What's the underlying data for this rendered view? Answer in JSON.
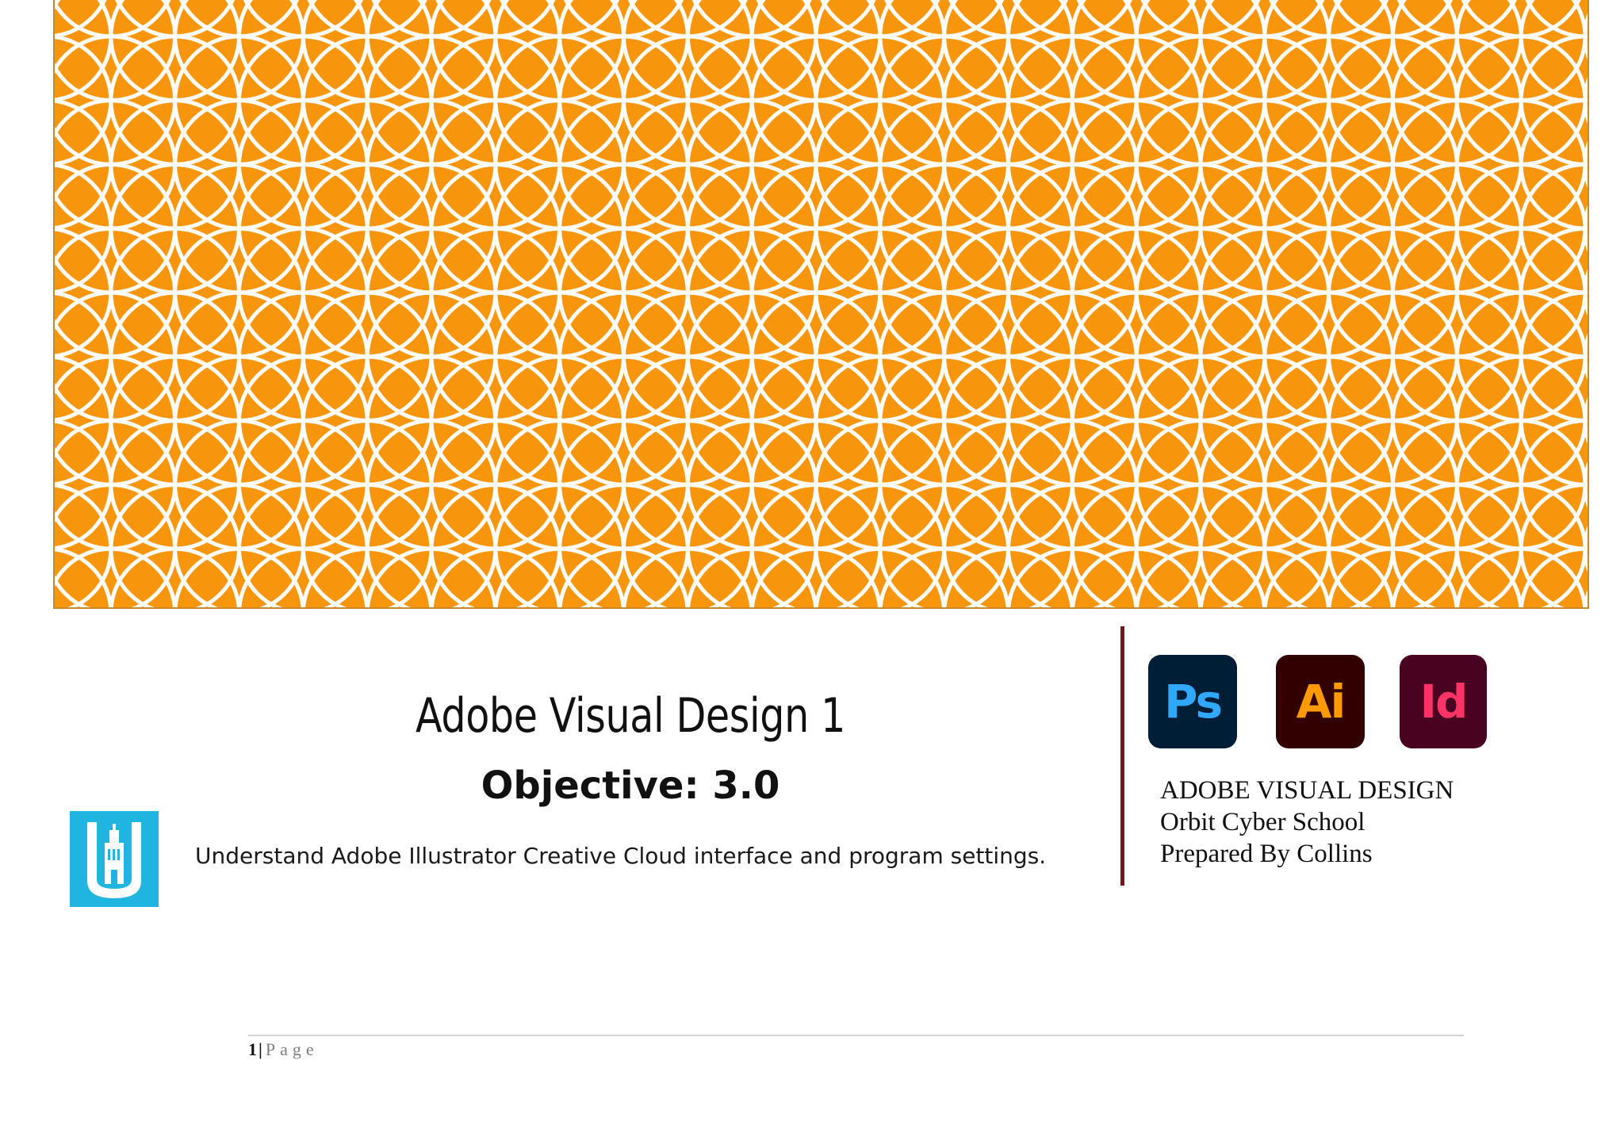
{
  "banner": {
    "pattern_name": "overlapping-circles-pattern",
    "background_color": "#f7960c",
    "line_color": "#ffffff"
  },
  "cover": {
    "title": "Adobe Visual Design 1",
    "objective": "Objective: 3.0",
    "description": "Understand Adobe Illustrator Creative Cloud interface and program settings."
  },
  "school_logo": {
    "icon": "school-building-logo-icon",
    "color": "#1fb5e0"
  },
  "apps": [
    {
      "label": "Ps",
      "icon": "photoshop-icon",
      "bg": "#001e36",
      "fg": "#31a8ff"
    },
    {
      "label": "Ai",
      "icon": "illustrator-icon",
      "bg": "#330000",
      "fg": "#ff9a00"
    },
    {
      "label": "Id",
      "icon": "indesign-icon",
      "bg": "#49021f",
      "fg": "#ff3366"
    }
  ],
  "info": {
    "line1": "ADOBE VISUAL DESIGN",
    "line2": "Orbit Cyber School",
    "line3": "Prepared By Collins"
  },
  "divider_color": "#7a1420",
  "footer": {
    "page_number": "1",
    "separator": "|",
    "page_label": "Page"
  }
}
